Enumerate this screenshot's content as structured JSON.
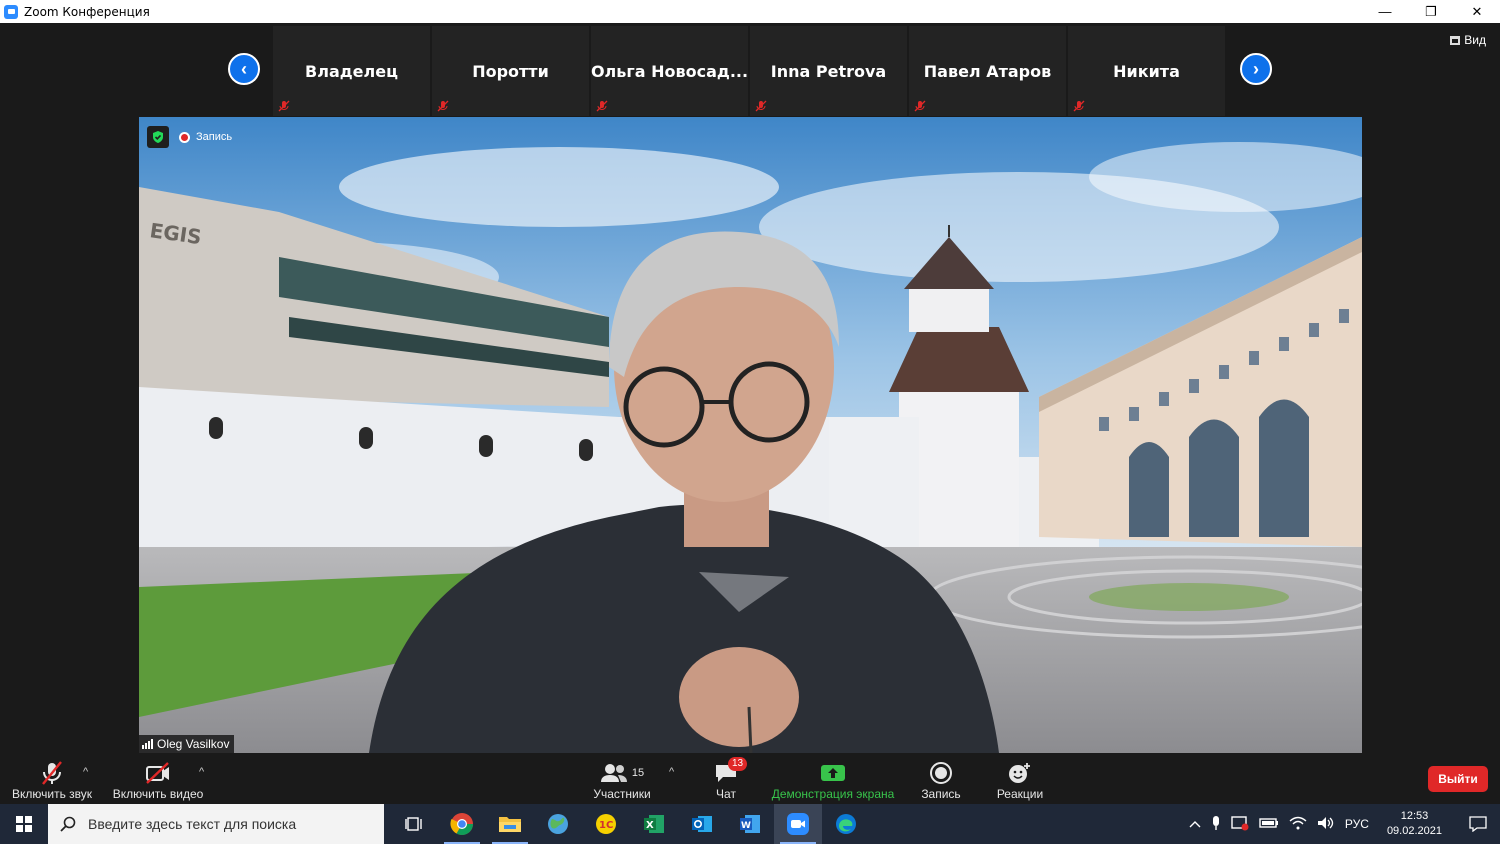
{
  "window": {
    "title": "Zoom Конференция",
    "minimize": "—",
    "restore": "❐",
    "close": "✕"
  },
  "view_button": {
    "label": "Вид"
  },
  "participants_strip": [
    {
      "name": "Владелец"
    },
    {
      "name": "Поротти"
    },
    {
      "name": "Ольга  Новосад..."
    },
    {
      "name": "Inna Petrova"
    },
    {
      "name": "Павел Атаров"
    },
    {
      "name": "Никита"
    }
  ],
  "nav": {
    "prev": "‹",
    "next": "›"
  },
  "video": {
    "recording_label": "Запись",
    "speaker_name": "Oleg Vasilkov",
    "building_sign": "EGIS"
  },
  "toolbar": {
    "unmute_label": "Включить звук",
    "start_video_label": "Включить видео",
    "participants_label": "Участники",
    "participants_count": "15",
    "chat_label": "Чат",
    "chat_badge": "13",
    "share_label": "Демонстрация экрана",
    "record_label": "Запись",
    "reactions_label": "Реакции",
    "leave_label": "Выйти",
    "caret": "^"
  },
  "taskbar": {
    "search_placeholder": "Введите здесь текст для поиска",
    "language": "РУС",
    "time": "12:53",
    "date": "09.02.2021",
    "apps": [
      "task-view",
      "chrome",
      "file-explorer",
      "maps",
      "1c",
      "excel",
      "outlook",
      "word",
      "zoom",
      "edge"
    ]
  },
  "colors": {
    "accent": "#0e71eb",
    "leave": "#e02828",
    "share_green": "#38c34b",
    "muted_red": "#e02828"
  }
}
